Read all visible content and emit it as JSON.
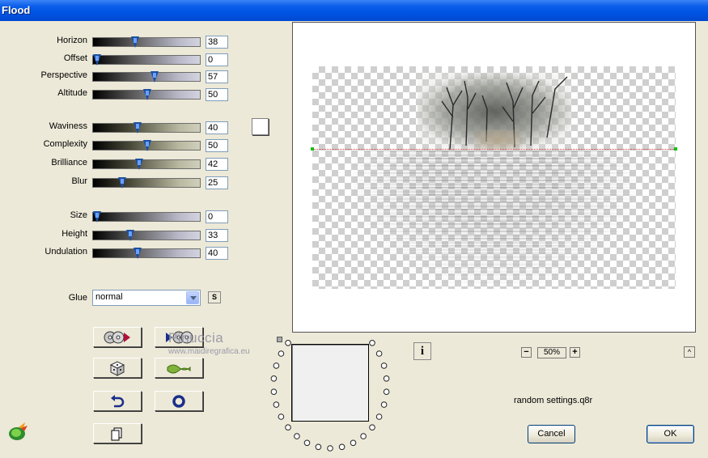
{
  "window": {
    "title": "Flood"
  },
  "params_group1": [
    {
      "label": "Horizon",
      "value": "38",
      "fraction": 0.38
    },
    {
      "label": "Offset",
      "value": "0",
      "fraction": 0.0
    },
    {
      "label": "Perspective",
      "value": "57",
      "fraction": 0.57
    },
    {
      "label": "Altitude",
      "value": "50",
      "fraction": 0.5
    }
  ],
  "params_group2": [
    {
      "label": "Waviness",
      "value": "40",
      "fraction": 0.4
    },
    {
      "label": "Complexity",
      "value": "50",
      "fraction": 0.5
    },
    {
      "label": "Brilliance",
      "value": "42",
      "fraction": 0.42
    },
    {
      "label": "Blur",
      "value": "25",
      "fraction": 0.25
    }
  ],
  "params_group3": [
    {
      "label": "Size",
      "value": "0",
      "fraction": 0.0
    },
    {
      "label": "Height",
      "value": "33",
      "fraction": 0.33
    },
    {
      "label": "Undulation",
      "value": "40",
      "fraction": 0.4
    }
  ],
  "glue": {
    "label": "Glue",
    "selected": "normal",
    "side_button": "S"
  },
  "tool_buttons": [
    {
      "name": "load-preset",
      "icon": "disc-arrow-icon"
    },
    {
      "name": "save-preset",
      "icon": "arrow-disc-icon"
    },
    {
      "name": "randomize",
      "icon": "dice-icon"
    },
    {
      "name": "wave-preset",
      "icon": "wave-icon"
    },
    {
      "name": "undo",
      "icon": "undo-icon"
    },
    {
      "name": "reset",
      "icon": "ring-icon"
    },
    {
      "name": "copy",
      "icon": "copy-icon"
    }
  ],
  "watermark": {
    "name": "Pinuccia",
    "site": "www.maidiregrafica.eu"
  },
  "preview": {
    "zoom": "50%",
    "info_label": "i",
    "zoom_out": "−",
    "zoom_in": "+",
    "collapse": "^"
  },
  "status": {
    "filename": "random settings.q8r"
  },
  "buttons": {
    "cancel": "Cancel",
    "ok": "OK"
  },
  "colors": {
    "titlebar": "#0054e3",
    "dialog_bg": "#ece9d8",
    "thumb": "#1c50a0",
    "horizon_marker": "#16c016"
  }
}
